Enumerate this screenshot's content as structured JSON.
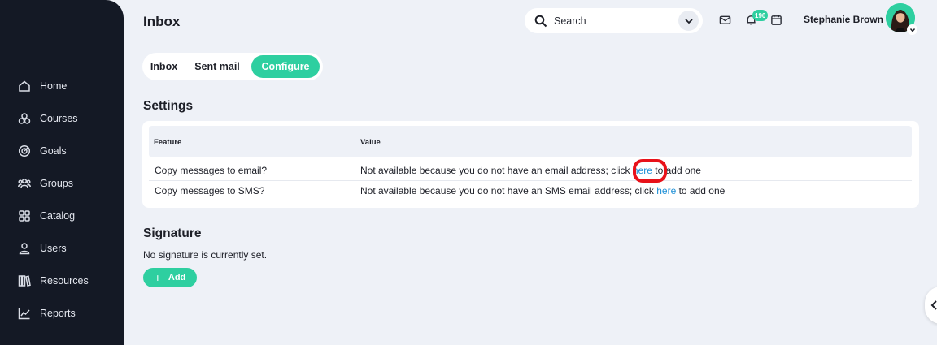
{
  "header": {
    "title": "Inbox",
    "search_placeholder": "Search",
    "notification_count": "190",
    "user_name": "Stephanie Brown"
  },
  "sidebar": {
    "items": [
      {
        "label": "Home",
        "icon": "home-icon"
      },
      {
        "label": "Courses",
        "icon": "courses-icon"
      },
      {
        "label": "Goals",
        "icon": "goals-icon"
      },
      {
        "label": "Groups",
        "icon": "groups-icon"
      },
      {
        "label": "Catalog",
        "icon": "catalog-icon"
      },
      {
        "label": "Users",
        "icon": "users-icon"
      },
      {
        "label": "Resources",
        "icon": "resources-icon"
      },
      {
        "label": "Reports",
        "icon": "reports-icon"
      }
    ]
  },
  "tabs": [
    {
      "label": "Inbox",
      "active": false
    },
    {
      "label": "Sent mail",
      "active": false
    },
    {
      "label": "Configure",
      "active": true
    }
  ],
  "settings": {
    "title": "Settings",
    "columns": [
      "Feature",
      "Value"
    ],
    "rows": [
      {
        "feature": "Copy messages to email?",
        "value_before": "Not available because you do not have an email address; click",
        "link": "here",
        "value_after": "to add one"
      },
      {
        "feature": "Copy messages to SMS?",
        "value_before": "Not available because you do not have an SMS email address; click",
        "link": "here",
        "value_after": "to add one"
      }
    ]
  },
  "signature": {
    "title": "Signature",
    "status": "No signature is currently set.",
    "add_label": "Add"
  },
  "colors": {
    "accent": "#2ecfa0",
    "sidebar_bg": "#141925",
    "page_bg": "#eef1f7",
    "link": "#1d8fd6",
    "highlight": "#e8121a"
  }
}
